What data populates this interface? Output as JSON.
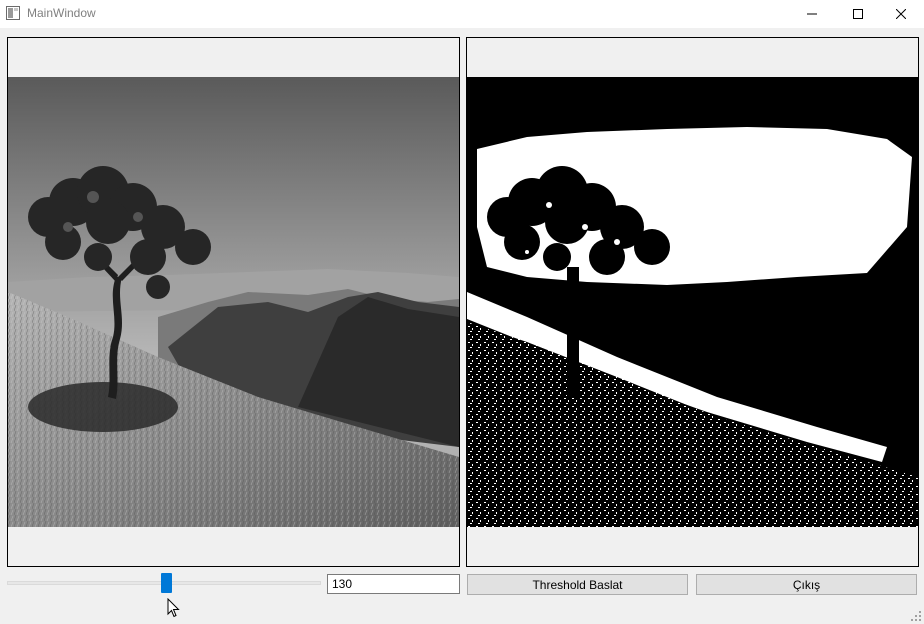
{
  "window": {
    "title": "MainWindow",
    "icon": "app-window-icon",
    "controls": [
      "minimize-icon",
      "maximize-icon",
      "close-icon"
    ]
  },
  "images": {
    "original": {
      "description_icon": "grayscale-landscape-image"
    },
    "threshold": {
      "description_icon": "binary-threshold-image"
    }
  },
  "controls": {
    "slider": {
      "min": 0,
      "max": 255,
      "value": 130
    },
    "threshold_input": "130",
    "threshold_button": "Threshold Baslat",
    "exit_button": "Çıkış"
  },
  "colors": {
    "accent": "#0078d7",
    "background": "#f0f0f0",
    "button": "#e1e1e1"
  }
}
